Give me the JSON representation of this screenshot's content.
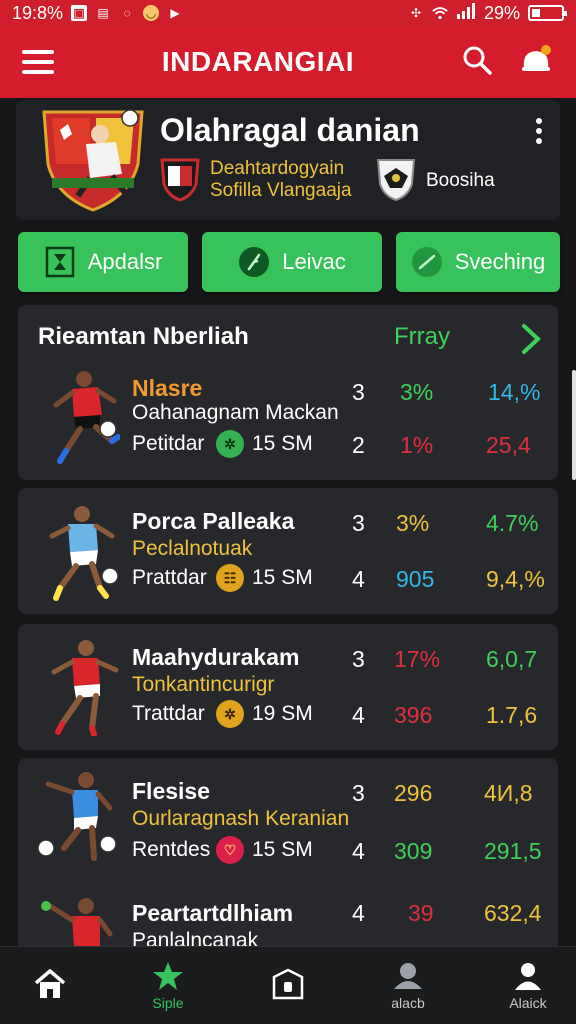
{
  "status_bar": {
    "time": "19:8%",
    "battery": "29%",
    "battery_level": 0.29
  },
  "app_bar": {
    "title": "INDARANGIAI"
  },
  "match": {
    "title": "Olahragal danian",
    "home_team": {
      "line1": "Deahtardogyain",
      "line2": "Sofilla Vlangaaja"
    },
    "away_team": "Boosiha"
  },
  "tabs": [
    {
      "label": "Apdalsr",
      "icon": "hourglass-icon"
    },
    {
      "label": "Leivac",
      "icon": "feather-icon"
    },
    {
      "label": "Sveching",
      "icon": "check-circle-icon"
    }
  ],
  "section": {
    "title": "Rieamtan Nberliah",
    "link": "Frray"
  },
  "players": [
    {
      "name": "Nlasre",
      "sub": "Oahanagnam Mackan",
      "pos": "Petitdar",
      "time": "15 SM",
      "a": "3",
      "b": "2",
      "c1": "3%",
      "c2": "1%",
      "d1": "14,%",
      "d2": "25,4",
      "name_color": "#f29a2e",
      "sub_color": "#ffffff",
      "c1_color": "#3fd05a",
      "c2_color": "#e0303f",
      "d1_color": "#2fb8e8",
      "d2_color": "#e0303f",
      "ic_bg": "#34b24f",
      "ic_fg": "#0d3a16",
      "ic_text": "✲"
    },
    {
      "name": "Porca Palleaka",
      "sub": "Peclalnotuak",
      "pos": "Prattdar",
      "time": "15 SM",
      "a": "3",
      "b": "4",
      "c1": "3%",
      "c2": "905",
      "d1": "4.7%",
      "d2": "9,4,%",
      "name_color": "#ffffff",
      "sub_color": "#f0c23b",
      "c1_color": "#f0c23b",
      "c2_color": "#2fb8e8",
      "d1_color": "#3fd05a",
      "d2_color": "#f0c23b",
      "ic_bg": "#e0a41c",
      "ic_fg": "#3a2600",
      "ic_text": "☷"
    },
    {
      "name": "Maahydurakam",
      "sub": "Tonkantincurigr",
      "pos": "Trattdar",
      "time": "19 SM",
      "a": "3",
      "b": "4",
      "c1": "17%",
      "c2": "396",
      "d1": "6,0,7",
      "d2": "1.7,6",
      "name_color": "#ffffff",
      "sub_color": "#f0c23b",
      "c1_color": "#e0303f",
      "c2_color": "#e0303f",
      "d1_color": "#3fd05a",
      "d2_color": "#f0c23b",
      "ic_bg": "#e0a41c",
      "ic_fg": "#3a2600",
      "ic_text": "✲"
    },
    {
      "name": "Flesise",
      "sub": "Ourlaragnash Keranian",
      "pos": "Rentdes",
      "time": "15 SM",
      "a": "3",
      "b": "4",
      "c1": "296",
      "c2": "309",
      "d1": "4И,8",
      "d2": "291,5",
      "name_color": "#ffffff",
      "sub_color": "#f0c23b",
      "c1_color": "#f0c23b",
      "c2_color": "#3fd05a",
      "d1_color": "#f0c23b",
      "d2_color": "#3fd05a",
      "ic_bg": "#d9214a",
      "ic_fg": "#f5c66a",
      "ic_text": "♡"
    },
    {
      "name": "Peartartdlhiam",
      "sub": "Panlalncanak",
      "a": "4",
      "c1": "39",
      "d1": "632,4",
      "name_color": "#ffffff",
      "sub_color": "#ffffff",
      "c1_color": "#e0303f",
      "d1_color": "#f0c23b"
    }
  ],
  "bottom_nav": [
    {
      "label": "",
      "icon": "home-icon"
    },
    {
      "label": "Siple",
      "icon": "star-icon"
    },
    {
      "label": "",
      "icon": "ticket-icon"
    },
    {
      "label": "alacb",
      "icon": "chat-icon"
    },
    {
      "label": "Alaick",
      "icon": "profile-icon"
    }
  ]
}
